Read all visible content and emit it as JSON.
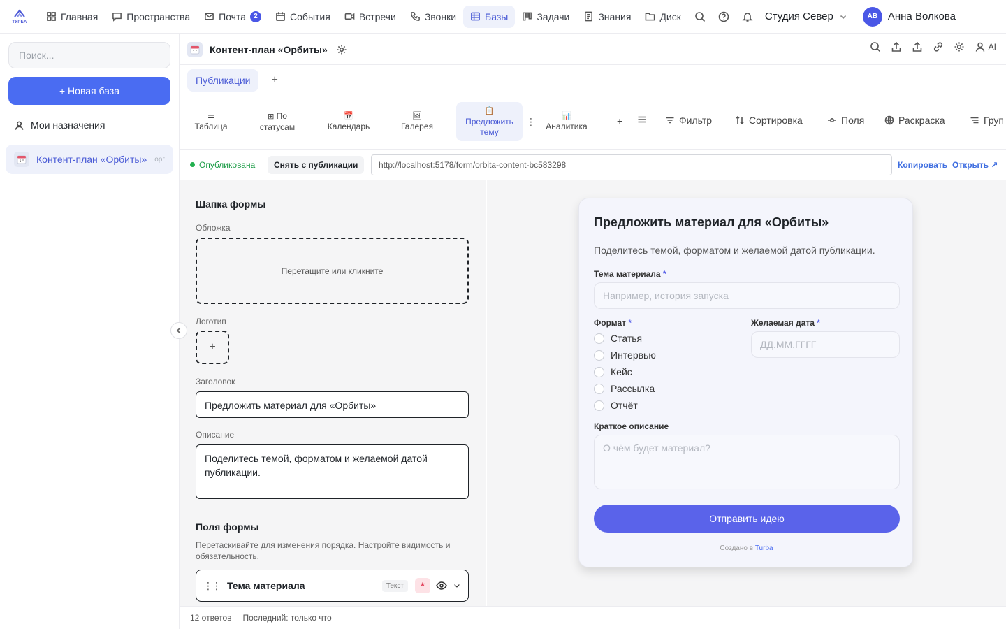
{
  "app": {
    "logo_text": "ТУРБА"
  },
  "nav": {
    "items": [
      {
        "label": "Главная",
        "icon": "grid-icon"
      },
      {
        "label": "Пространства",
        "icon": "chat-icon"
      },
      {
        "label": "Почта",
        "icon": "mail-icon",
        "badge": "2"
      },
      {
        "label": "События",
        "icon": "calendar-icon"
      },
      {
        "label": "Встречи",
        "icon": "video-icon"
      },
      {
        "label": "Звонки",
        "icon": "phone-icon"
      },
      {
        "label": "Базы",
        "icon": "table-icon",
        "active": true
      },
      {
        "label": "Задачи",
        "icon": "kanban-icon"
      },
      {
        "label": "Знания",
        "icon": "book-icon"
      },
      {
        "label": "Диск",
        "icon": "folder-icon"
      }
    ],
    "workspace": "Студия Север",
    "user_initials": "АВ",
    "user_name": "Анна Волкова"
  },
  "sidebar": {
    "search_placeholder": "Поиск...",
    "new_base": "+ Новая база",
    "my_assignments": "Мои назначения",
    "base_name": "Контент-план «Орбиты»",
    "base_tag": "орг"
  },
  "header": {
    "title": "Контент-план «Орбиты»",
    "ai_label": "AI"
  },
  "tabs": {
    "active": "Публикации",
    "add": "+"
  },
  "views": {
    "table": {
      "icon": "☰",
      "label": "Таблица"
    },
    "status": {
      "icon": "⊞",
      "label1": "По",
      "label2": "статусам"
    },
    "calendar": {
      "icon": "📅",
      "label": "Календарь"
    },
    "gallery": {
      "icon": "🖼",
      "label": "Галерея"
    },
    "form": {
      "icon": "📋",
      "label1": "Предложить",
      "label2": "тему"
    },
    "analytics": {
      "icon": "📊",
      "label": "Аналитика"
    },
    "add": "+",
    "filter": "Фильтр",
    "sort": "Сортировка",
    "fields": "Поля",
    "coloring": "Раскраска",
    "group": "Груп"
  },
  "publish": {
    "status": "Опубликована",
    "unpublish": "Снять с публикации",
    "url": "http://localhost:5178/form/orbita-content-bc583298",
    "copy": "Копировать",
    "open": "Открыть ↗"
  },
  "editor": {
    "header_section": "Шапка формы",
    "cover_label": "Обложка",
    "cover_hint": "Перетащите или кликните",
    "logo_label": "Логотип",
    "logo_add": "+",
    "title_label": "Заголовок",
    "title_value": "Предложить материал для «Орбиты»",
    "desc_label": "Описание",
    "desc_value": "Поделитесь темой, форматом и желаемой датой публикации.",
    "fields_section": "Поля формы",
    "fields_hint": "Перетаскивайте для изменения порядка. Настройте видимость и обязательность.",
    "field1_name": "Тема материала",
    "field1_type": "Текст",
    "field1_required": "*"
  },
  "form": {
    "title": "Предложить материал для «Орбиты»",
    "description": "Поделитесь темой, форматом и желаемой датой публикации.",
    "topic_label": "Тема материала",
    "topic_placeholder": "Например, история запуска",
    "format_label": "Формат",
    "formats": [
      "Статья",
      "Интервью",
      "Кейс",
      "Рассылка",
      "Отчёт"
    ],
    "date_label": "Желаемая дата",
    "date_placeholder": "ДД.ММ.ГГГГ",
    "summary_label": "Краткое описание",
    "summary_placeholder": "О чём будет материал?",
    "required_mark": "*",
    "submit": "Отправить идею",
    "credit_prefix": "Создано в",
    "credit_brand": "Turba"
  },
  "footer": {
    "responses": "12 ответов",
    "last": "Последний: только что"
  },
  "colors": {
    "accent": "#4a6cf2",
    "submit": "#5a63ea",
    "published": "#22b04f"
  }
}
